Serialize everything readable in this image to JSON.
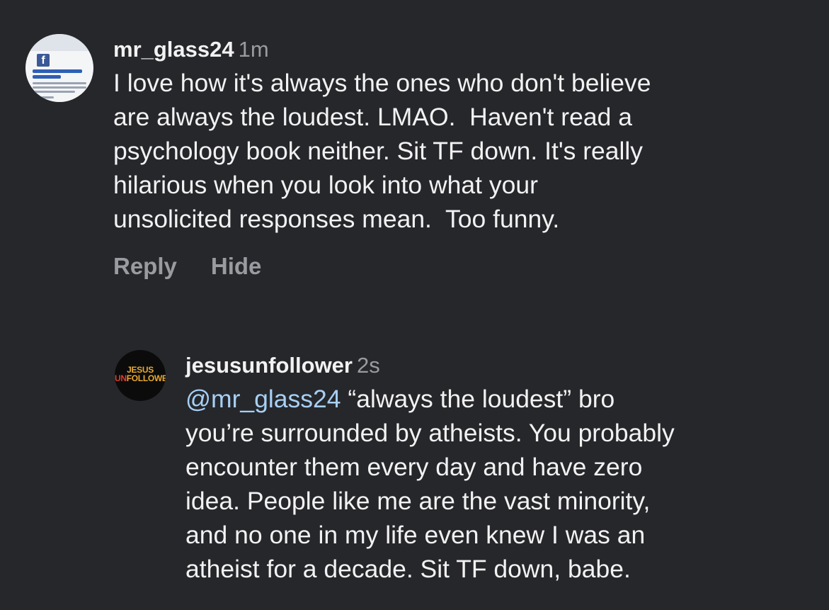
{
  "comments": [
    {
      "username": "mr_glass24",
      "time": "1m",
      "text": "I love how it's always the ones who don't believe\nare always the loudest. LMAO.  Haven't read a\npsychology book neither. Sit TF down. It's really\nhilarious when you look into what your\nunsolicited responses mean.  Too funny.",
      "actions": {
        "reply": "Reply",
        "hide": "Hide"
      },
      "avatar_icon": "facebook-post-screenshot-icon"
    },
    {
      "username": "jesusunfollower",
      "time": "2s",
      "mention": "@mr_glass24",
      "text": " “always the loudest” bro\nyou’re surrounded by atheists. You probably\nencounter them every day and have zero\nidea. People like me are the vast minority,\nand no one in my life even knew I was an\natheist for a decade. Sit TF down, babe.",
      "avatar_icon": "jesus-unfollower-logo-icon",
      "avatar_logo": {
        "line1": "JESUS",
        "line2_prefix": "UN",
        "line2_rest": "FOLLOWER"
      }
    }
  ],
  "colors": {
    "background": "#26272b",
    "text": "#f2f2f2",
    "secondary": "#9a9ba0",
    "mention": "#a7d0f6"
  }
}
